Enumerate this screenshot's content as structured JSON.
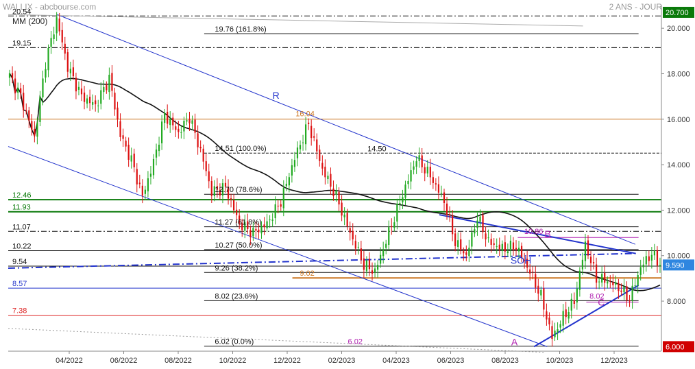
{
  "header": {
    "title": "WALLIX - abcbourse.com",
    "period": "2 ANS - JOUR",
    "ma_label": "MM (200)"
  },
  "chart_data": {
    "type": "candlestick",
    "title": "WALLIX - abcbourse.com",
    "ylim": [
      5.8,
      21.0
    ],
    "y_ticks": [
      8.0,
      10.0,
      12.0,
      14.0,
      16.0,
      18.0,
      20.0
    ],
    "y_tick_labels": [
      "8.000",
      "10.000",
      "12.000",
      "14.000",
      "16.000",
      "18.000",
      "20.000"
    ],
    "x_labels": [
      "04/2022",
      "06/2022",
      "08/2022",
      "10/2022",
      "12/2022",
      "02/2023",
      "04/2023",
      "06/2023",
      "08/2023",
      "10/2023",
      "12/2023"
    ],
    "current_price": "9.590",
    "current_price_value": 9.59,
    "badges": [
      {
        "text": "20.700",
        "value": 20.7,
        "color": "#0a7a0a"
      },
      {
        "text": "9.590",
        "value": 9.59,
        "color": "#2f86e0"
      },
      {
        "text": "6.000",
        "value": 6.0,
        "color": "#d00000"
      }
    ],
    "moving_average": {
      "name": "MM (200)",
      "color": "#111111"
    },
    "candles": {
      "bull_color": "#22aa22",
      "bear_color": "#dd1111",
      "anchors": [
        {
          "i": 0,
          "v": 17.9
        },
        {
          "i": 4,
          "v": 17.0
        },
        {
          "i": 9,
          "v": 15.2
        },
        {
          "i": 13,
          "v": 18.5
        },
        {
          "i": 17,
          "v": 20.4
        },
        {
          "i": 21,
          "v": 18.3
        },
        {
          "i": 26,
          "v": 17.0
        },
        {
          "i": 31,
          "v": 16.6
        },
        {
          "i": 36,
          "v": 17.8
        },
        {
          "i": 40,
          "v": 15.3
        },
        {
          "i": 44,
          "v": 14.2
        },
        {
          "i": 48,
          "v": 12.6
        },
        {
          "i": 52,
          "v": 14.1
        },
        {
          "i": 56,
          "v": 16.2
        },
        {
          "i": 61,
          "v": 15.4
        },
        {
          "i": 65,
          "v": 16.1
        },
        {
          "i": 69,
          "v": 14.6
        },
        {
          "i": 73,
          "v": 12.8
        },
        {
          "i": 78,
          "v": 13.0
        },
        {
          "i": 83,
          "v": 11.4
        },
        {
          "i": 88,
          "v": 11.0
        },
        {
          "i": 93,
          "v": 11.4
        },
        {
          "i": 98,
          "v": 12.4
        },
        {
          "i": 103,
          "v": 14.3
        },
        {
          "i": 108,
          "v": 15.8
        },
        {
          "i": 113,
          "v": 13.8
        },
        {
          "i": 118,
          "v": 12.6
        },
        {
          "i": 123,
          "v": 11.0
        },
        {
          "i": 128,
          "v": 9.6
        },
        {
          "i": 132,
          "v": 9.3
        },
        {
          "i": 137,
          "v": 11.0
        },
        {
          "i": 142,
          "v": 12.7
        },
        {
          "i": 147,
          "v": 14.3
        },
        {
          "i": 152,
          "v": 13.5
        },
        {
          "i": 157,
          "v": 12.4
        },
        {
          "i": 161,
          "v": 10.6
        },
        {
          "i": 165,
          "v": 10.0
        },
        {
          "i": 169,
          "v": 11.7
        },
        {
          "i": 173,
          "v": 10.6
        },
        {
          "i": 178,
          "v": 10.3
        },
        {
          "i": 183,
          "v": 10.4
        },
        {
          "i": 188,
          "v": 9.3
        },
        {
          "i": 192,
          "v": 8.2
        },
        {
          "i": 196,
          "v": 6.4
        },
        {
          "i": 200,
          "v": 7.3
        },
        {
          "i": 204,
          "v": 8.0
        },
        {
          "i": 208,
          "v": 10.5
        },
        {
          "i": 212,
          "v": 9.0
        },
        {
          "i": 216,
          "v": 8.9
        },
        {
          "i": 220,
          "v": 8.6
        },
        {
          "i": 224,
          "v": 8.1
        },
        {
          "i": 228,
          "v": 9.5
        },
        {
          "i": 232,
          "v": 10.1
        },
        {
          "i": 235,
          "v": 9.59
        }
      ]
    },
    "levels": [
      {
        "value": 20.54,
        "label": "20.54",
        "color": "#111111",
        "style": "dashdot",
        "x1": 0.0,
        "x2": 1.0,
        "lx": 0.0
      },
      {
        "value": 19.76,
        "label": "19.76  (161.8%)",
        "color": "#111111",
        "style": "solid",
        "x1": 0.3,
        "x2": 0.965,
        "lx": 0.31
      },
      {
        "value": 19.15,
        "label": "19.15",
        "color": "#111111",
        "style": "dashdot",
        "x1": 0.0,
        "x2": 1.0,
        "lx": 0.0
      },
      {
        "value": 16.0,
        "label": "",
        "color": "#cc7722",
        "style": "solid",
        "x1": 0.0,
        "x2": 1.0,
        "lx": 0.0
      },
      {
        "value": 14.51,
        "label": "14.51  (100.0%)",
        "color": "#111111",
        "style": "dashed",
        "x1": 0.3,
        "x2": 1.0,
        "lx": 0.31
      },
      {
        "value": 12.7,
        "label": "12.70  (78.6%)",
        "color": "#111111",
        "style": "solid",
        "x1": 0.3,
        "x2": 0.965,
        "lx": 0.31
      },
      {
        "value": 12.46,
        "label": "12.46",
        "color": "#0a7a0a",
        "style": "thick",
        "x1": 0.0,
        "x2": 1.0,
        "lx": 0.0
      },
      {
        "value": 11.93,
        "label": "11.93",
        "color": "#0a7a0a",
        "style": "thick",
        "x1": 0.0,
        "x2": 1.0,
        "lx": 0.0
      },
      {
        "value": 11.27,
        "label": "11.27  (61.8%)",
        "color": "#111111",
        "style": "solid",
        "x1": 0.3,
        "x2": 0.965,
        "lx": 0.31
      },
      {
        "value": 11.07,
        "label": "11.07",
        "color": "#111111",
        "style": "dashdot",
        "x1": 0.0,
        "x2": 1.0,
        "lx": 0.0
      },
      {
        "value": 10.27,
        "label": "10.27  (50.0%)",
        "color": "#111111",
        "style": "solid",
        "x1": 0.3,
        "x2": 0.965,
        "lx": 0.31
      },
      {
        "value": 10.22,
        "label": "10.22",
        "color": "#111111",
        "style": "solid",
        "x1": 0.0,
        "x2": 1.0,
        "lx": 0.0
      },
      {
        "value": 9.54,
        "label": "9.54",
        "color": "#111111",
        "style": "solid",
        "x1": 0.0,
        "x2": 1.0,
        "lx": 0.0
      },
      {
        "value": 9.26,
        "label": "9.26  (38.2%)",
        "color": "#111111",
        "style": "solid",
        "x1": 0.3,
        "x2": 0.965,
        "lx": 0.31
      },
      {
        "value": 9.02,
        "label": "9.02",
        "color": "#cc7722",
        "style": "thick",
        "x1": 0.435,
        "x2": 1.0,
        "lx": 0.44
      },
      {
        "value": 8.57,
        "label": "8.57",
        "color": "#2233cc",
        "style": "solid",
        "x1": 0.0,
        "x2": 1.0,
        "lx": 0.0
      },
      {
        "value": 8.02,
        "label": "8.02  (23.6%)",
        "color": "#111111",
        "style": "solid",
        "x1": 0.3,
        "x2": 0.965,
        "lx": 0.31
      },
      {
        "value": 7.38,
        "label": "7.38",
        "color": "#dd2222",
        "style": "solid",
        "x1": 0.0,
        "x2": 1.0,
        "lx": 0.0
      },
      {
        "value": 6.02,
        "label": "6.02  (0.0%)",
        "color": "#111111",
        "style": "solid",
        "x1": 0.3,
        "x2": 0.965,
        "lx": 0.31
      }
    ],
    "level_labels_extra": [
      {
        "text": "16.04",
        "value": 16.04,
        "color": "#cc7722",
        "lx": 0.44
      },
      {
        "text": "14.50",
        "value": 14.5,
        "color": "#111111",
        "lx": 0.55
      },
      {
        "text": "10.86",
        "value": 10.86,
        "color": "#b020b0",
        "lx": 0.79
      },
      {
        "text": "8.02",
        "value": 8.02,
        "color": "#b020b0",
        "lx": 0.89
      },
      {
        "text": "6.02",
        "value": 6.02,
        "color": "#b020b0",
        "lx": 0.52
      }
    ],
    "short_levels": [
      {
        "value": 10.8,
        "color": "#b020b0",
        "x1": 0.78,
        "x2": 0.965
      },
      {
        "value": 7.96,
        "color": "#b020b0",
        "x1": 0.885,
        "x2": 0.965
      }
    ],
    "trendlines": [
      {
        "name": "upper-channel",
        "color": "#2233cc",
        "width": 1,
        "p1": [
          0.075,
          20.6
        ],
        "p2": [
          0.96,
          10.5
        ]
      },
      {
        "name": "lower-channel",
        "color": "#2233cc",
        "width": 1,
        "p1": [
          0.0,
          14.8
        ],
        "p2": [
          0.825,
          6.0
        ]
      },
      {
        "name": "mid-dashdot",
        "color": "#2233cc",
        "width": 2,
        "dash": "10,4,2,4",
        "p1": [
          0.0,
          9.45
        ],
        "p2": [
          0.965,
          10.1
        ]
      },
      {
        "name": "resistance",
        "color": "#2233cc",
        "width": 2,
        "p1": [
          0.66,
          11.8
        ],
        "p2": [
          0.96,
          10.1
        ]
      },
      {
        "name": "support",
        "color": "#2233cc",
        "width": 2,
        "p1": [
          0.805,
          6.0
        ],
        "p2": [
          0.965,
          8.7
        ]
      },
      {
        "name": "dotted-base",
        "color": "#999999",
        "width": 1,
        "dash": "2,3",
        "p1": [
          0.0,
          6.8
        ],
        "p2": [
          0.82,
          5.75
        ]
      },
      {
        "name": "grey-top",
        "color": "#aaaaaa",
        "width": 1,
        "p1": [
          0.0,
          20.6
        ],
        "p2": [
          0.88,
          20.1
        ]
      }
    ],
    "annotations": [
      {
        "text": "R",
        "color": "#2233cc",
        "x": 0.41,
        "v": 16.9
      },
      {
        "text": "SOH",
        "color": "#2233cc",
        "x": 0.785,
        "v": 9.65
      },
      {
        "text": "A",
        "color": "#b020b0",
        "x": 0.775,
        "v": 6.05
      },
      {
        "text": "B",
        "color": "#b020b0",
        "x": 0.826,
        "v": 10.8
      },
      {
        "text": "C",
        "color": "#b020b0",
        "x": 0.908,
        "v": 7.8
      }
    ]
  }
}
